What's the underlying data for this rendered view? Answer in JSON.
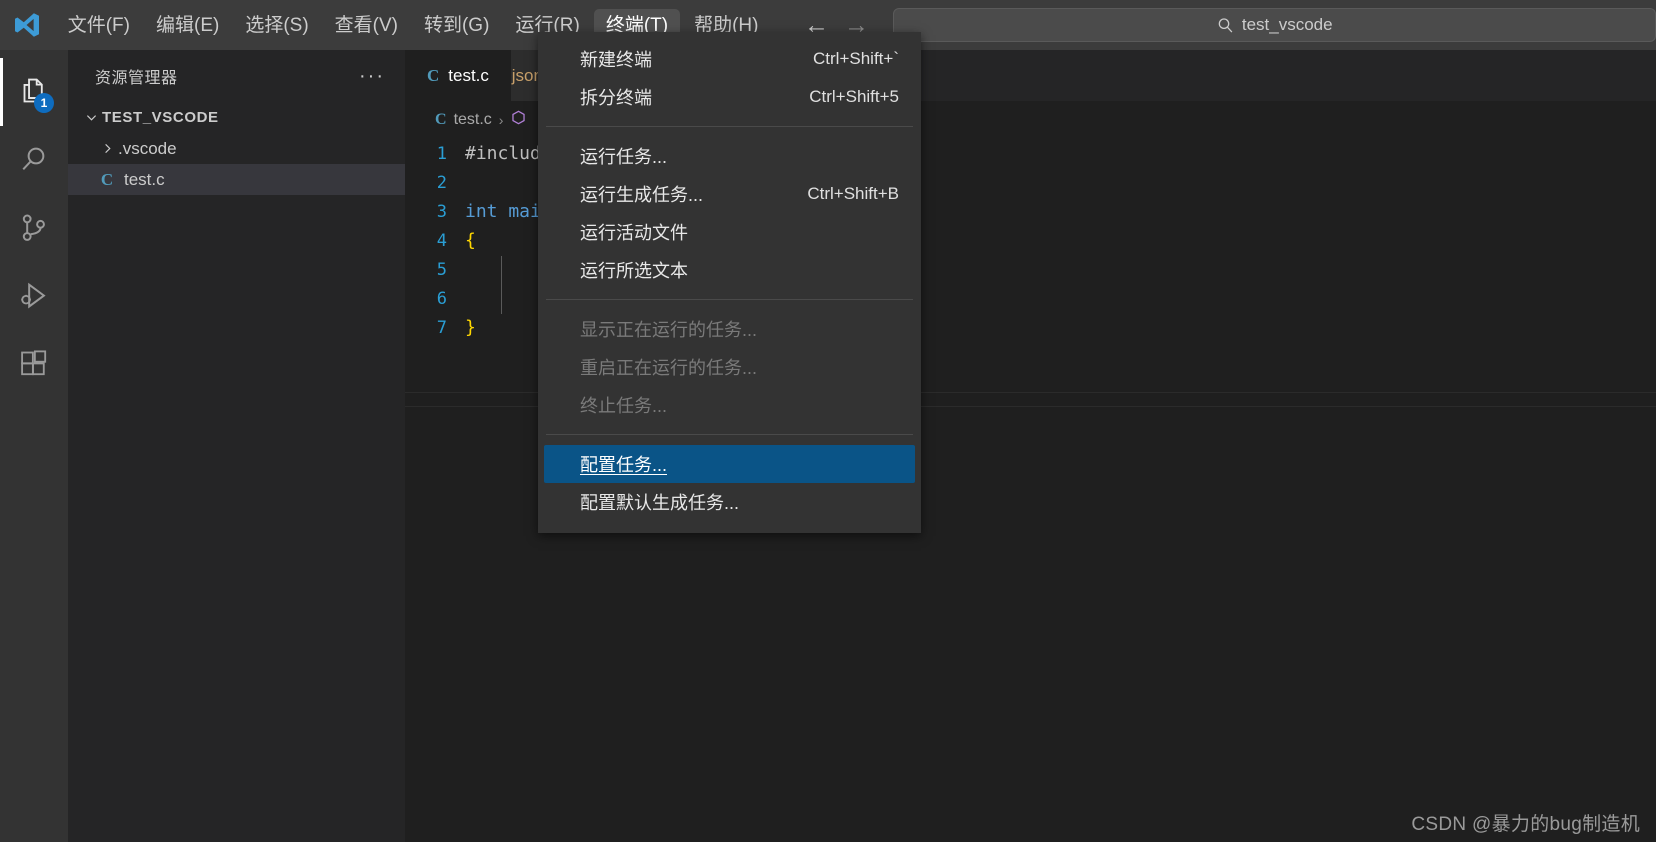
{
  "titlebar": {
    "logo_icon": "vscode-logo-icon",
    "menus": [
      {
        "label": "文件(F)",
        "active": false
      },
      {
        "label": "编辑(E)",
        "active": false
      },
      {
        "label": "选择(S)",
        "active": false
      },
      {
        "label": "查看(V)",
        "active": false
      },
      {
        "label": "转到(G)",
        "active": false
      },
      {
        "label": "运行(R)",
        "active": false
      },
      {
        "label": "终端(T)",
        "active": true
      },
      {
        "label": "帮助(H)",
        "active": false
      }
    ],
    "nav": {
      "back_icon": "arrow-left-icon",
      "forward_icon": "arrow-right-icon"
    },
    "quickinput": {
      "icon": "search-icon",
      "value": "test_vscode",
      "placeholder": ""
    }
  },
  "activitybar": {
    "items": [
      {
        "name": "explorer",
        "icon": "files-icon",
        "selected": true,
        "badge": "1"
      },
      {
        "name": "search",
        "icon": "search-icon",
        "selected": false,
        "badge": ""
      },
      {
        "name": "source-control",
        "icon": "source-control-icon",
        "selected": false,
        "badge": ""
      },
      {
        "name": "run-and-debug",
        "icon": "run-debug-icon",
        "selected": false,
        "badge": ""
      },
      {
        "name": "extensions",
        "icon": "extensions-icon",
        "selected": false,
        "badge": ""
      }
    ]
  },
  "sidebar": {
    "title": "资源管理器",
    "more_icon": "ellipsis-icon",
    "tree": [
      {
        "label": "TEST_VSCODE",
        "level": "root",
        "icon": "chevron-down-icon",
        "selected": false
      },
      {
        "label": ".vscode",
        "level": "child",
        "icon": "chevron-right-icon",
        "selected": false
      },
      {
        "label": "test.c",
        "level": "child",
        "icon": "c-file-icon",
        "selected": true
      }
    ]
  },
  "editor": {
    "tabs": [
      {
        "label": "test.c",
        "icon_letter": "C",
        "active": true
      },
      {
        "label": "tasks.json",
        "icon_letter": "{}",
        "active": false
      }
    ],
    "breadcrumb": {
      "file_icon_letter": "C",
      "file": "test.c",
      "separator": "›",
      "symbol_icon": "symbol-method-icon"
    },
    "lines": [
      {
        "no": "1",
        "segments": [
          {
            "text": "#include <stdio.h>",
            "tok": "pre"
          }
        ]
      },
      {
        "no": "2",
        "segments": [
          {
            "text": "",
            "tok": "plain"
          }
        ]
      },
      {
        "no": "3",
        "segments": [
          {
            "text": "int main()",
            "tok": "kw"
          }
        ]
      },
      {
        "no": "4",
        "segments": [
          {
            "text": "{",
            "tok": "br"
          }
        ]
      },
      {
        "no": "5",
        "segments": [
          {
            "text": "",
            "tok": "plain"
          }
        ]
      },
      {
        "no": "6",
        "segments": [
          {
            "text": "",
            "tok": "plain"
          }
        ]
      },
      {
        "no": "7",
        "segments": [
          {
            "text": "}",
            "tok": "br"
          }
        ]
      }
    ]
  },
  "terminal_menu": {
    "items": [
      {
        "label": "新建终端",
        "key": "Ctrl+Shift+`",
        "state": "normal"
      },
      {
        "label": "拆分终端",
        "key": "Ctrl+Shift+5",
        "state": "normal"
      },
      {
        "separator": true
      },
      {
        "label": "运行任务...",
        "key": "",
        "state": "normal"
      },
      {
        "label": "运行生成任务...",
        "key": "Ctrl+Shift+B",
        "state": "normal"
      },
      {
        "label": "运行活动文件",
        "key": "",
        "state": "normal"
      },
      {
        "label": "运行所选文本",
        "key": "",
        "state": "normal"
      },
      {
        "separator": true
      },
      {
        "label": "显示正在运行的任务...",
        "key": "",
        "state": "disabled"
      },
      {
        "label": "重启正在运行的任务...",
        "key": "",
        "state": "disabled"
      },
      {
        "label": "终止任务...",
        "key": "",
        "state": "disabled"
      },
      {
        "separator": true
      },
      {
        "label": "配置任务...",
        "key": "",
        "state": "highlight"
      },
      {
        "label": "配置默认生成任务...",
        "key": "",
        "state": "normal"
      }
    ]
  },
  "watermark": {
    "text": "CSDN @暴力的bug制造机"
  },
  "colors": {
    "accent_blue": "#0e6cbf",
    "menu_highlight": "#0a5487",
    "titlebar_bg": "#3c3c3c",
    "activitybar_bg": "#333333",
    "sidebar_bg": "#252526",
    "editor_bg": "#1f1f1f",
    "tab_active_bg": "#1f1f1f",
    "tab_inactive_bg": "#2d2d2d",
    "line_number": "#2a9ed4",
    "keyword": "#569cd6",
    "bracket": "#ffd700",
    "c_icon": "#519aba"
  }
}
